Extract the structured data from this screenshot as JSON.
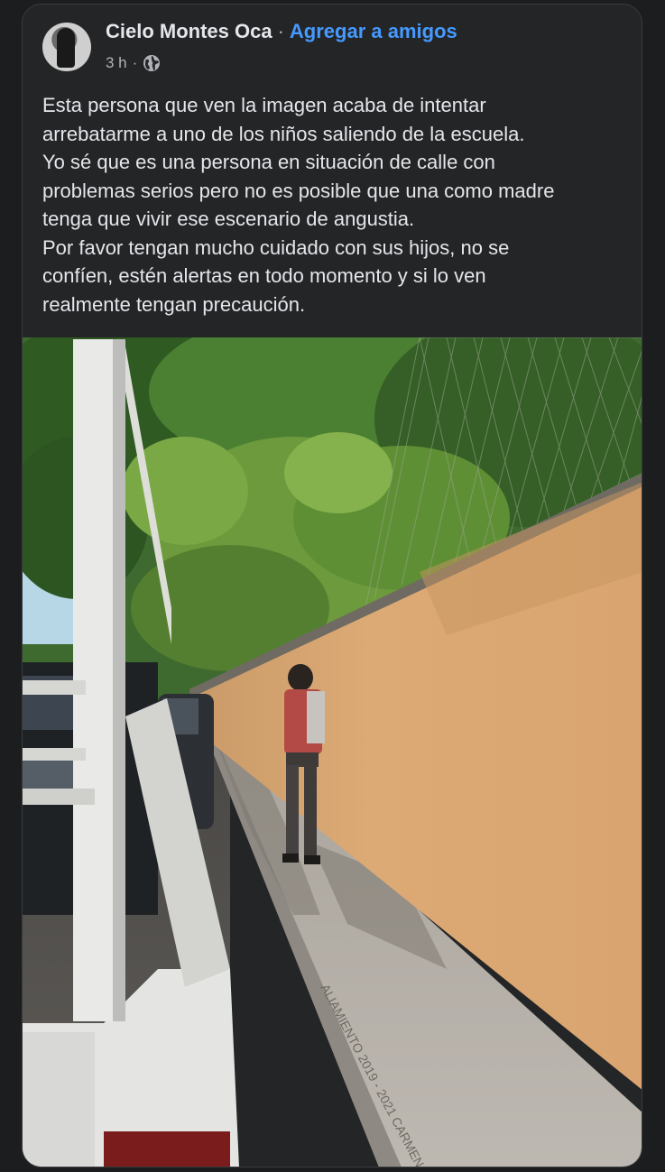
{
  "post": {
    "author_name": "Cielo Montes Oca",
    "separator": "·",
    "add_friend_label": "Agregar a amigos",
    "timestamp": "3 h",
    "meta_separator": "·",
    "privacy_icon": "globe-icon",
    "text_lines": [
      "Esta persona que ven la imagen acaba de intentar",
      "arrebatarme a uno de los niños saliendo de la escuela.",
      "Yo sé que es una persona en situación de calle con",
      "problemas serios pero no es posible que una como madre",
      "tenga que vivir ese escenario de angustia.",
      "Por favor tengan mucho cuidado con sus hijos, no se",
      "confíen, estén alertas en todo momento y si lo ven",
      "realmente tengan precaución."
    ]
  },
  "photo": {
    "sidewalk_inscription": "ALIAMIENTO 2019 - 2021 CARMEN"
  },
  "colors": {
    "background": "#1c1d1f",
    "card": "#242526",
    "text": "#e4e6eb",
    "secondary_text": "#b0b3b8",
    "link": "#4599ff"
  }
}
